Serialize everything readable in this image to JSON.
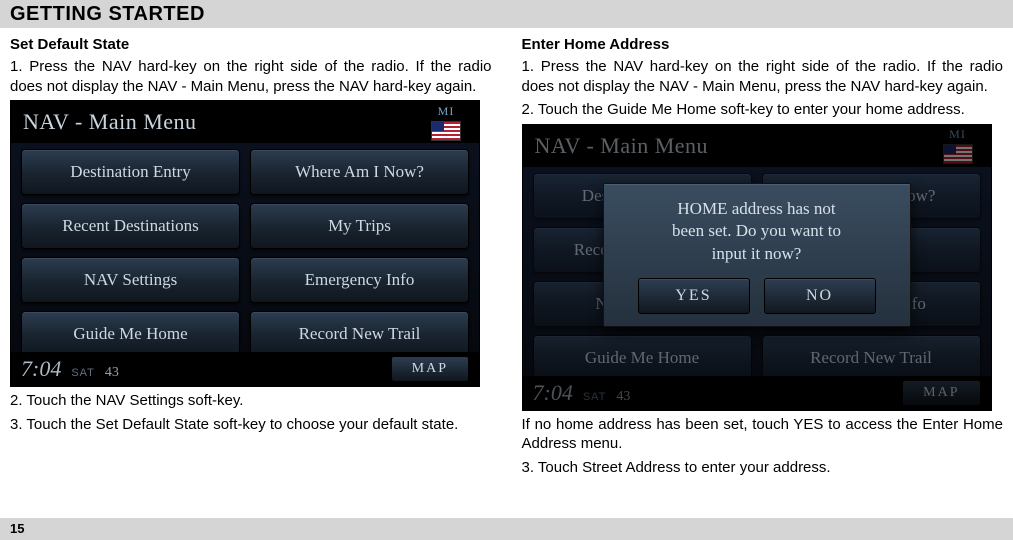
{
  "header": {
    "title": "GETTING STARTED"
  },
  "footer": {
    "page": "15"
  },
  "left": {
    "heading": "Set Default State",
    "p1": "1. Press the NAV hard-key on the right side of the radio. If the radio does not display the NAV - Main Menu, press the NAV hard-key again.",
    "p2": "2. Touch the NAV Settings soft-key.",
    "p3": "3. Touch the Set Default State soft-key to choose your default state."
  },
  "right": {
    "heading": "Enter Home Address",
    "p1": "1. Press the NAV hard-key on the right side of the radio. If the radio does not display the NAV - Main Menu, press the NAV hard-key again.",
    "p2": "2. Touch the Guide Me Home soft-key to enter your home address.",
    "p3": "If no home address has been set, touch YES to access the Enter Home Address menu.",
    "p4": "3. Touch Street Address to enter your address."
  },
  "nav": {
    "title_a": "NAV",
    "title_dash": " - ",
    "title_b": "Main Menu",
    "mi": "MI",
    "buttons": {
      "b0": "Destination Entry",
      "b1": "Where Am I Now?",
      "b2": "Recent Destinations",
      "b3": "My Trips",
      "b4": "NAV Settings",
      "b5": "Emergency Info",
      "b6": "Guide Me Home",
      "b7": "Record New Trail"
    },
    "clock": "7:04",
    "sat": "SAT",
    "temp": "43",
    "map": "MAP"
  },
  "dialog": {
    "line1": "HOME address has not",
    "line2": "been set. Do you want to",
    "line3": "input it now?",
    "yes": "YES",
    "no": "NO"
  }
}
